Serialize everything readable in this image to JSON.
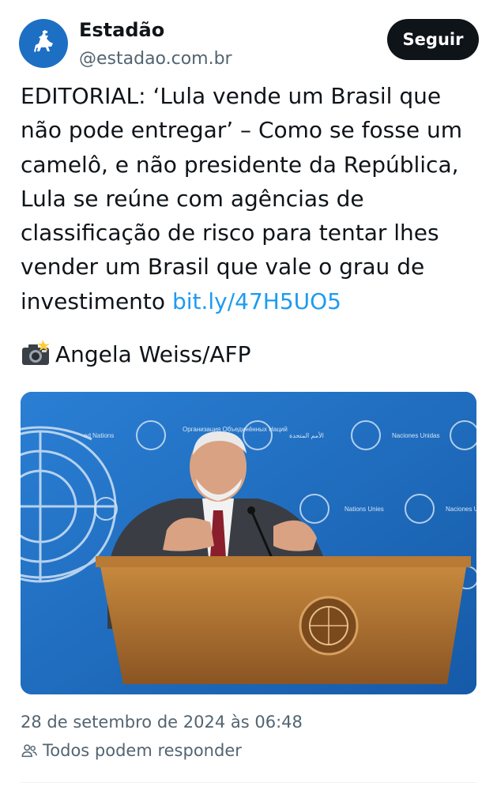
{
  "author": {
    "name": "Estadão",
    "handle": "@estadao.com.br",
    "follow_label": "Seguir"
  },
  "post": {
    "text": "EDITORIAL: ‘Lula vende um Brasil que não pode entregar’ – Como se fosse um camelô, e não presidente da República, Lula se reúne com agências de classificação de risco para tentar lhes vender um Brasil que vale o grau de investimento ",
    "link": "bit.ly/47H5UO5",
    "photo_credit": "Angela Weiss/AFP",
    "date": "28 de setembro de 2024 às 06:48",
    "reply_setting": "Todos podem responder"
  },
  "media": {
    "backdrop_labels": [
      "ed Nations",
      "Организация Объединённых Наций",
      "الأمم المتحدة",
      "Naciones Unidas",
      "Nations Unies",
      "Naciones U"
    ]
  },
  "colors": {
    "link": "#1d9bf0",
    "text": "#0f1419",
    "secondary": "#536471",
    "follow_bg": "#0f1419",
    "backdrop": "#1f6fc0"
  },
  "icons": [
    "estadao-logo-icon",
    "camera-flash-icon",
    "people-icon"
  ]
}
